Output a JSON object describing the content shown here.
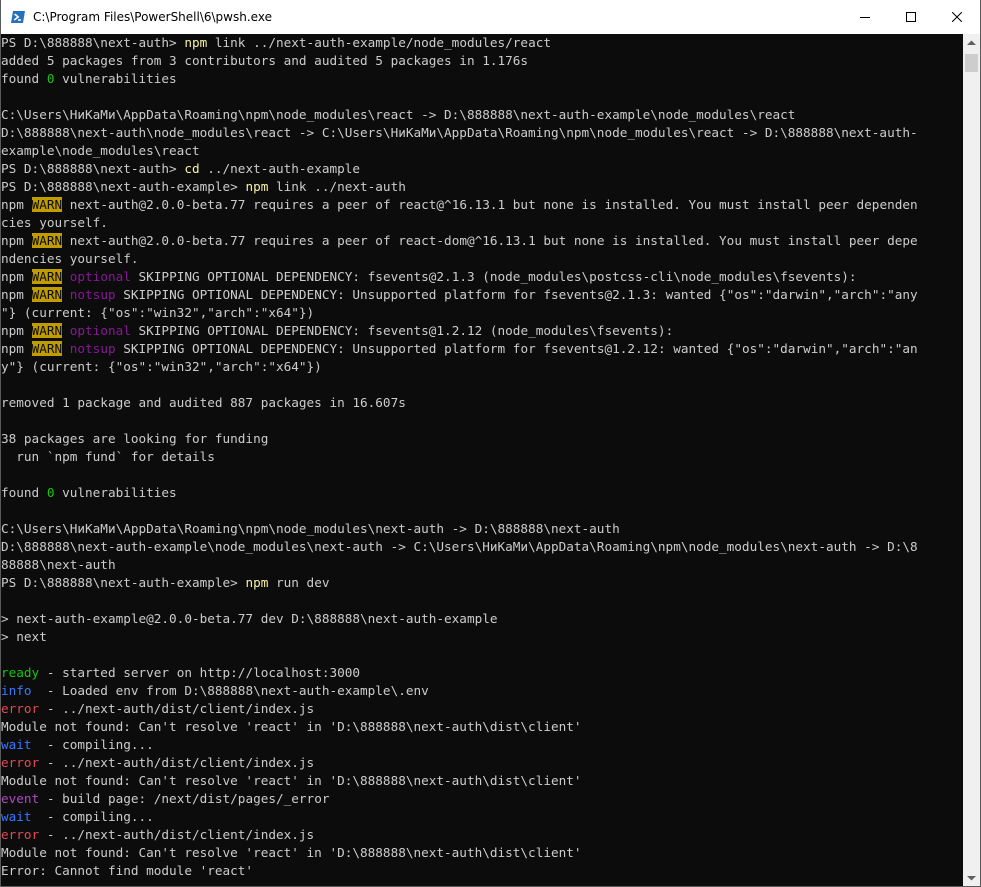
{
  "window": {
    "title": "C:\\Program Files\\PowerShell\\6\\pwsh.exe",
    "icon": "powershell-icon",
    "controls": [
      "minimize-icon",
      "maximize-icon",
      "close-icon"
    ]
  },
  "colors": {
    "background": "#0c0c0c",
    "foreground": "#cccccc",
    "command": "#f9f1a5",
    "green": "#16c60c",
    "blue": "#3b78ff",
    "red": "#e74856",
    "magenta": "#b148c6",
    "warn_background": "#c19c00"
  },
  "console": {
    "lines": [
      [
        {
          "t": "PS D:\\888888\\next-auth> "
        },
        {
          "t": "npm",
          "c": "y"
        },
        {
          "t": " link ../next-auth-example/node_modules/react"
        }
      ],
      [
        {
          "t": "added 5 packages from 3 contributors and audited 5 packages in 1.176s"
        }
      ],
      [
        {
          "t": "found "
        },
        {
          "t": "0",
          "c": "g"
        },
        {
          "t": " vulnerabilities"
        }
      ],
      [
        {
          "t": ""
        }
      ],
      [
        {
          "t": "C:\\Users\\НиКаМи\\AppData\\Roaming\\npm\\node_modules\\react -> D:\\888888\\next-auth-example\\node_modules\\react"
        }
      ],
      [
        {
          "t": "D:\\888888\\next-auth\\node_modules\\react -> C:\\Users\\НиКаМи\\AppData\\Roaming\\npm\\node_modules\\react -> D:\\888888\\next-auth-"
        }
      ],
      [
        {
          "t": "example\\node_modules\\react"
        }
      ],
      [
        {
          "t": "PS D:\\888888\\next-auth> "
        },
        {
          "t": "cd",
          "c": "y"
        },
        {
          "t": " ../next-auth-example"
        }
      ],
      [
        {
          "t": "PS D:\\888888\\next-auth-example> "
        },
        {
          "t": "npm",
          "c": "y"
        },
        {
          "t": " link ../next-auth"
        }
      ],
      [
        {
          "t": "npm "
        },
        {
          "t": "WARN",
          "c": "warn"
        },
        {
          "t": " next-auth@2.0.0-beta.77 requires a peer of react@^16.13.1 but none is installed. You must install peer dependen"
        }
      ],
      [
        {
          "t": "cies yourself."
        }
      ],
      [
        {
          "t": "npm "
        },
        {
          "t": "WARN",
          "c": "warn"
        },
        {
          "t": " next-auth@2.0.0-beta.77 requires a peer of react-dom@^16.13.1 but none is installed. You must install peer depe"
        }
      ],
      [
        {
          "t": "ndencies yourself."
        }
      ],
      [
        {
          "t": "npm "
        },
        {
          "t": "WARN",
          "c": "warn"
        },
        {
          "t": " "
        },
        {
          "t": "optional",
          "c": "p"
        },
        {
          "t": " SKIPPING OPTIONAL DEPENDENCY: fsevents@2.1.3 (node_modules\\postcss-cli\\node_modules\\fsevents):"
        }
      ],
      [
        {
          "t": "npm "
        },
        {
          "t": "WARN",
          "c": "warn"
        },
        {
          "t": " "
        },
        {
          "t": "notsup",
          "c": "p"
        },
        {
          "t": " SKIPPING OPTIONAL DEPENDENCY: Unsupported platform for fsevents@2.1.3: wanted {\"os\":\"darwin\",\"arch\":\"any"
        }
      ],
      [
        {
          "t": "\"} (current: {\"os\":\"win32\",\"arch\":\"x64\"})"
        }
      ],
      [
        {
          "t": "npm "
        },
        {
          "t": "WARN",
          "c": "warn"
        },
        {
          "t": " "
        },
        {
          "t": "optional",
          "c": "p"
        },
        {
          "t": " SKIPPING OPTIONAL DEPENDENCY: fsevents@1.2.12 (node_modules\\fsevents):"
        }
      ],
      [
        {
          "t": "npm "
        },
        {
          "t": "WARN",
          "c": "warn"
        },
        {
          "t": " "
        },
        {
          "t": "notsup",
          "c": "p"
        },
        {
          "t": " SKIPPING OPTIONAL DEPENDENCY: Unsupported platform for fsevents@1.2.12: wanted {\"os\":\"darwin\",\"arch\":\"an"
        }
      ],
      [
        {
          "t": "y\"} (current: {\"os\":\"win32\",\"arch\":\"x64\"})"
        }
      ],
      [
        {
          "t": ""
        }
      ],
      [
        {
          "t": "removed 1 package and audited 887 packages in 16.607s"
        }
      ],
      [
        {
          "t": ""
        }
      ],
      [
        {
          "t": "38 packages are looking for funding"
        }
      ],
      [
        {
          "t": "  run `npm fund` for details"
        }
      ],
      [
        {
          "t": ""
        }
      ],
      [
        {
          "t": "found "
        },
        {
          "t": "0",
          "c": "g"
        },
        {
          "t": " vulnerabilities"
        }
      ],
      [
        {
          "t": ""
        }
      ],
      [
        {
          "t": "C:\\Users\\НиКаМи\\AppData\\Roaming\\npm\\node_modules\\next-auth -> D:\\888888\\next-auth"
        }
      ],
      [
        {
          "t": "D:\\888888\\next-auth-example\\node_modules\\next-auth -> C:\\Users\\НиКаМи\\AppData\\Roaming\\npm\\node_modules\\next-auth -> D:\\8"
        }
      ],
      [
        {
          "t": "88888\\next-auth"
        }
      ],
      [
        {
          "t": "PS D:\\888888\\next-auth-example> "
        },
        {
          "t": "npm",
          "c": "y"
        },
        {
          "t": " run dev"
        }
      ],
      [
        {
          "t": ""
        }
      ],
      [
        {
          "t": "> next-auth-example@2.0.0-beta.77 dev D:\\888888\\next-auth-example"
        }
      ],
      [
        {
          "t": "> next"
        }
      ],
      [
        {
          "t": ""
        }
      ],
      [
        {
          "t": "ready",
          "c": "g"
        },
        {
          "t": " - started server on http://localhost:3000"
        }
      ],
      [
        {
          "t": "info",
          "c": "b"
        },
        {
          "t": "  - Loaded env from D:\\888888\\next-auth-example\\.env"
        }
      ],
      [
        {
          "t": "error",
          "c": "r"
        },
        {
          "t": " - ../next-auth/dist/client/index.js"
        }
      ],
      [
        {
          "t": "Module not found: Can't resolve 'react' in 'D:\\888888\\next-auth\\dist\\client'"
        }
      ],
      [
        {
          "t": "wait",
          "c": "b"
        },
        {
          "t": "  - compiling..."
        }
      ],
      [
        {
          "t": "error",
          "c": "r"
        },
        {
          "t": " - ../next-auth/dist/client/index.js"
        }
      ],
      [
        {
          "t": "Module not found: Can't resolve 'react' in 'D:\\888888\\next-auth\\dist\\client'"
        }
      ],
      [
        {
          "t": "event",
          "c": "m"
        },
        {
          "t": " - build page: /next/dist/pages/_error"
        }
      ],
      [
        {
          "t": "wait",
          "c": "b"
        },
        {
          "t": "  - compiling..."
        }
      ],
      [
        {
          "t": "error",
          "c": "r"
        },
        {
          "t": " - ../next-auth/dist/client/index.js"
        }
      ],
      [
        {
          "t": "Module not found: Can't resolve 'react' in 'D:\\888888\\next-auth\\dist\\client'"
        }
      ],
      [
        {
          "t": "Error: Cannot find module 'react'"
        }
      ]
    ]
  },
  "scrollbar": {
    "up_icon": "scroll-up-arrow-icon",
    "down_icon": "scroll-down-arrow-icon"
  }
}
